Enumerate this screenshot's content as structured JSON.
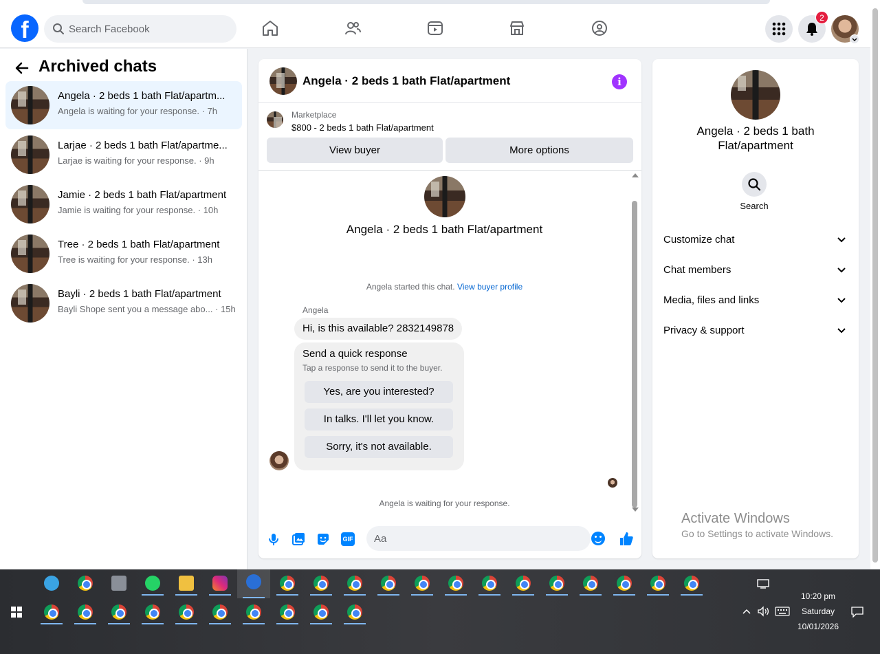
{
  "navbar": {
    "logo": "f",
    "search_placeholder": "Search Facebook",
    "notification_count": "2",
    "icons": [
      "home-icon",
      "friends-icon",
      "video-icon",
      "marketplace-icon",
      "groups-icon",
      "menu-grid-icon",
      "bell-icon"
    ]
  },
  "archived": {
    "title": "Archived chats",
    "chats": [
      {
        "name": "Angela · 2 beds 1 bath Flat/apartm...",
        "sub": "Angela is waiting for your response. · 7h"
      },
      {
        "name": "Larjae · 2 beds 1 bath Flat/apartme...",
        "sub": "Larjae is waiting for your response. · 9h"
      },
      {
        "name": "Jamie · 2 beds 1 bath Flat/apartment",
        "sub": "Jamie is waiting for your response. · 10h"
      },
      {
        "name": "Tree · 2 beds 1 bath Flat/apartment",
        "sub": "Tree is waiting for your response. · 13h"
      },
      {
        "name": "Bayli · 2 beds 1 bath Flat/apartment",
        "sub": "Bayli Shope sent you a message abo... · 15h"
      }
    ]
  },
  "conversation": {
    "title": "Angela · 2 beds 1 bath Flat/apartment",
    "marketplace_label": "Marketplace",
    "listing": "$800 - 2 beds 1 bath Flat/apartment",
    "view_buyer": "View buyer",
    "more_options": "More options",
    "center_name": "Angela · 2 beds 1 bath Flat/apartment",
    "started_text": "Angela started this chat.",
    "view_buyer_profile": "View buyer profile",
    "sender": "Angela",
    "message": "Hi, is this available? 2832149878",
    "quick_title": "Send a quick response",
    "quick_sub": "Tap a response to send it to the buyer.",
    "quick_replies": [
      "Yes, are you interested?",
      "In talks. I'll let you know.",
      "Sorry, it's not available."
    ],
    "waiting": "Angela is waiting for your response.",
    "composer_placeholder": "Aa",
    "gif_label": "GIF"
  },
  "info_panel": {
    "name": "Angela · 2 beds 1 bath Flat/apartment",
    "search_label": "Search",
    "sections": [
      "Customize chat",
      "Chat members",
      "Media, files and links",
      "Privacy & support"
    ]
  },
  "watermark": {
    "line1": "Activate Windows",
    "line2": "Go to Settings to activate Windows."
  },
  "taskbar": {
    "time": "10:20 pm",
    "day": "Saturday",
    "date": "10/01/2026"
  },
  "colors": {
    "facebook_blue": "#0866ff",
    "messenger_blue": "#0084ff",
    "badge_red": "#e41e3f",
    "info_purple": "#a033ff"
  }
}
